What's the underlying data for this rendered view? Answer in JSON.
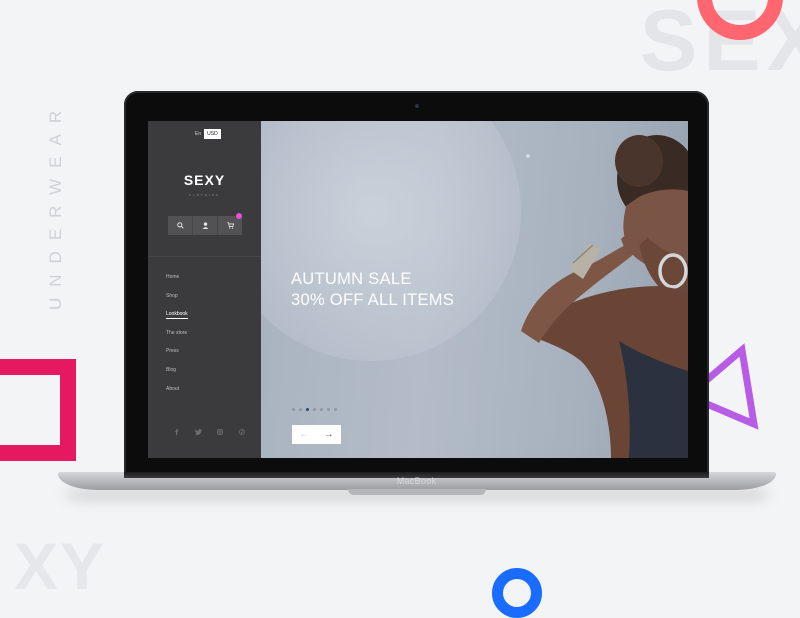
{
  "decor": {
    "bg_letters_top": "SEX",
    "bg_letters_bottom": "XY",
    "vertical_word": "UNDERWEAR",
    "colors": {
      "ring_top": "#ff6670",
      "ring_bottom": "#1a6cff",
      "square": "#e5195f",
      "triangle": "#b85ce6"
    }
  },
  "laptop": {
    "brand": "MacBook"
  },
  "site": {
    "language": "En",
    "currency": "USD",
    "logo": "SEXY",
    "logo_sub": "CLOTHING",
    "header_icons": [
      "search-icon",
      "user-icon",
      "cart-icon"
    ],
    "nav": {
      "items": [
        "Home",
        "Shop",
        "Lookbook",
        "The store",
        "Press",
        "Blog",
        "About"
      ],
      "active": "Lookbook"
    },
    "social_icons": [
      "facebook-icon",
      "twitter-icon",
      "instagram-icon",
      "pinterest-icon"
    ],
    "accent": "#e84fd6"
  },
  "hero": {
    "headline_line1": "AUTUMN SALE",
    "headline_line2": "30% OFF ALL ITEMS",
    "slider": {
      "count": 7,
      "active_index": 2
    },
    "prev_symbol": "←",
    "next_symbol": "→"
  }
}
